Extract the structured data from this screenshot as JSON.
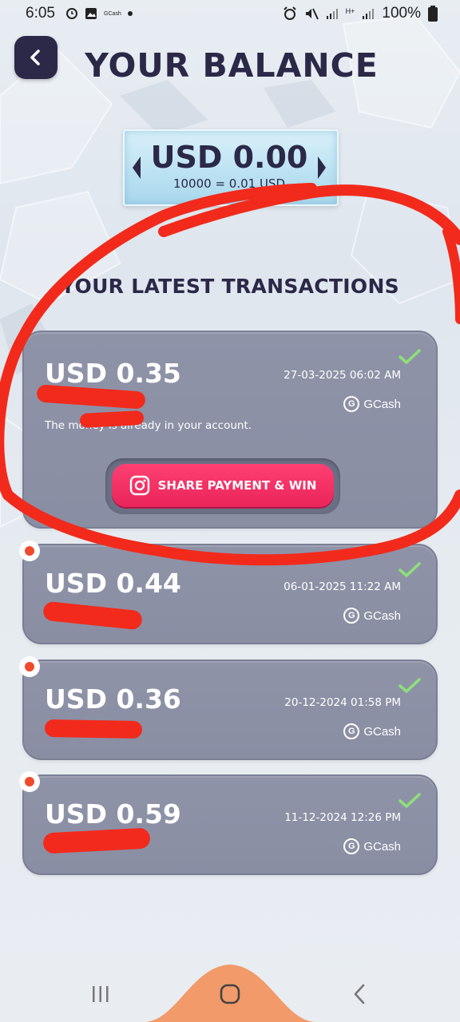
{
  "status_bar": {
    "time": "6:05",
    "mini_app_label": "GCash",
    "signal_tag": "H+",
    "battery": "100%"
  },
  "header": {
    "title": "YOUR BALANCE"
  },
  "balance": {
    "amount": "USD 0.00",
    "rate": "10000 = 0.01 USD"
  },
  "transactions_section": {
    "title": "YOUR LATEST TRANSACTIONS"
  },
  "transactions": [
    {
      "amount": "USD 0.35",
      "date": "27-03-2025 06:02 AM",
      "provider": "GCash",
      "message": "The money is already in your account.",
      "share_label": "SHARE PAYMENT & WIN",
      "status": "completed"
    },
    {
      "amount": "USD 0.44",
      "date": "06-01-2025 11:22 AM",
      "provider": "GCash",
      "status": "completed",
      "new": true
    },
    {
      "amount": "USD 0.36",
      "date": "20-12-2024 01:58 PM",
      "provider": "GCash",
      "status": "completed",
      "new": true
    },
    {
      "amount": "USD 0.59",
      "date": "11-12-2024 12:26 PM",
      "provider": "GCash",
      "status": "completed",
      "new": true
    }
  ],
  "colors": {
    "title": "#2b2848",
    "card": "#8f93a8",
    "share_button": "#ee2b5f",
    "check": "#8ee07a",
    "annotation": "#f22a1c",
    "nav_hump": "#f29a6a"
  },
  "icons": {
    "back": "chevron-left-icon",
    "check": "check-icon",
    "share": "instagram-icon",
    "provider": "gcash-logo-icon"
  }
}
